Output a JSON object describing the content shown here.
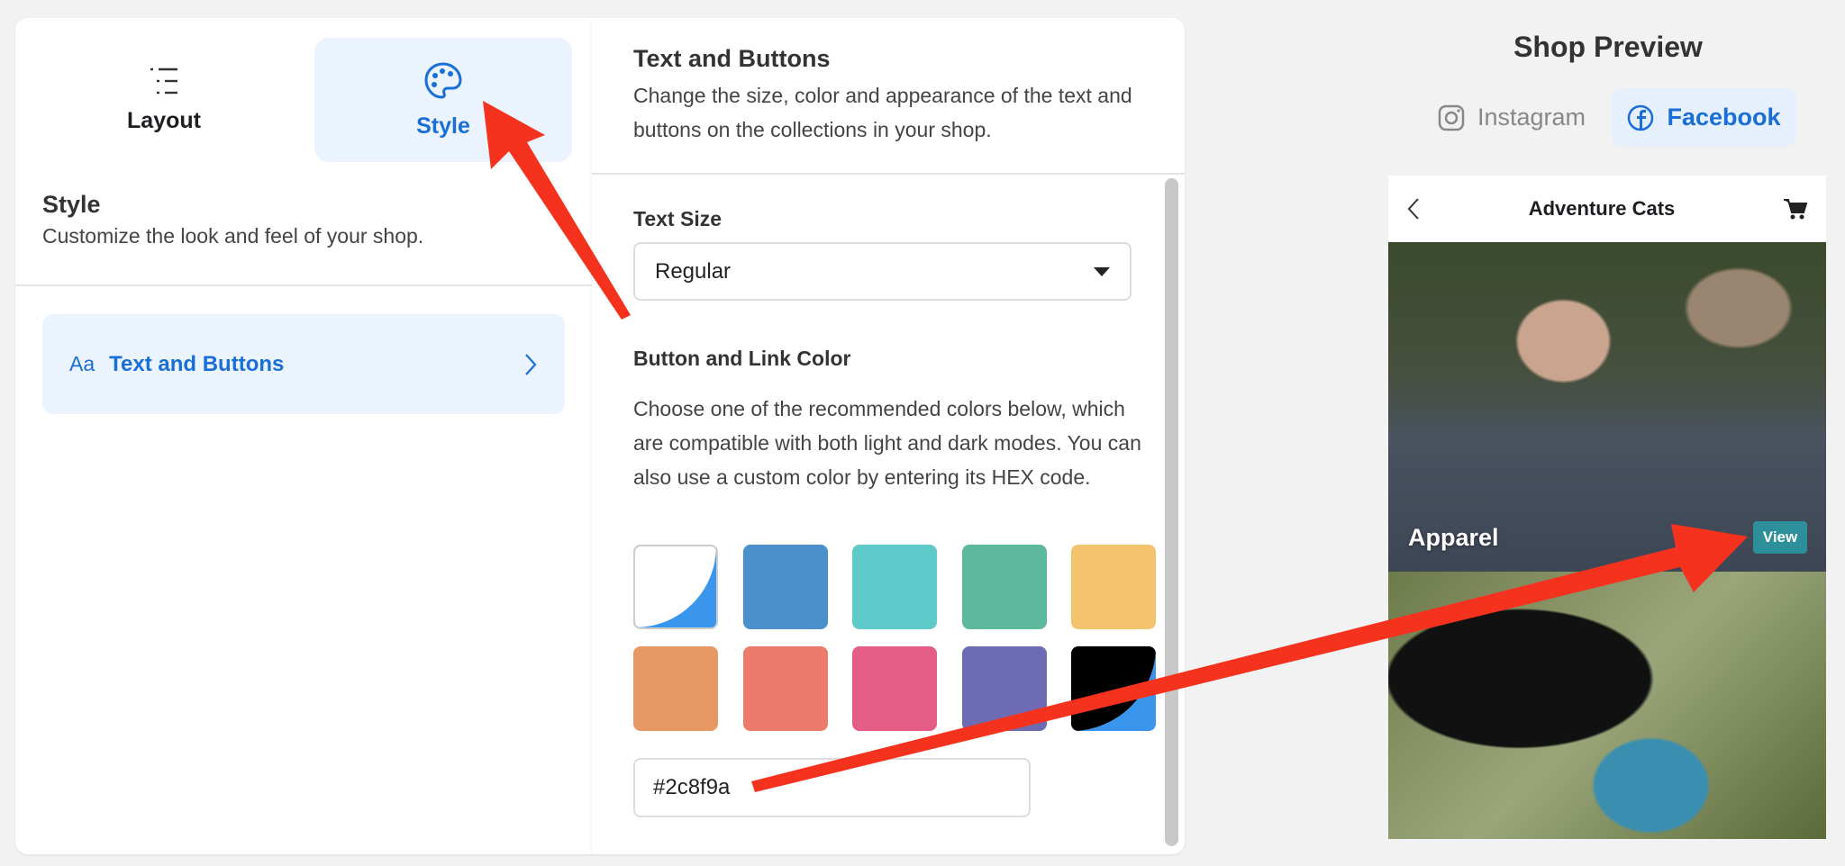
{
  "left_panel": {
    "tabs": [
      {
        "label": "Layout",
        "icon": "list-icon",
        "active": false
      },
      {
        "label": "Style",
        "icon": "palette-icon",
        "active": true
      }
    ],
    "section_title": "Style",
    "section_desc": "Customize the look and feel of your shop.",
    "items": [
      {
        "prefix": "Aa",
        "label": "Text and Buttons",
        "icon": "chevron-right-icon"
      }
    ]
  },
  "middle_panel": {
    "title": "Text and Buttons",
    "desc": "Change the size, color and appearance of the text and buttons on the collections in your shop.",
    "text_size_label": "Text Size",
    "text_size_value": "Regular",
    "color_label": "Button and Link Color",
    "color_desc": "Choose one of the recommended colors below, which are compatible with both light and dark modes. You can also use a custom color by entering its HEX code.",
    "swatches": [
      "#ffffff/#3a96ec",
      "#4a90cc",
      "#5ecaca",
      "#5db99e",
      "#f3c36e",
      "#e89862",
      "#ec7b6b",
      "#e45d87",
      "#6d6cb3",
      "#000000/#3a96ec"
    ],
    "hex_value": "#2c8f9a"
  },
  "preview": {
    "title": "Shop Preview",
    "tabs": [
      {
        "label": "Instagram",
        "icon": "instagram-icon",
        "active": false
      },
      {
        "label": "Facebook",
        "icon": "facebook-icon",
        "active": true
      }
    ],
    "shop_name": "Adventure Cats",
    "collections": [
      {
        "label": "Apparel",
        "button": "View"
      }
    ],
    "button_color": "#2c8f9a"
  },
  "colors": {
    "accent": "#1a6ed8",
    "annotation_arrow": "#f5321e"
  }
}
